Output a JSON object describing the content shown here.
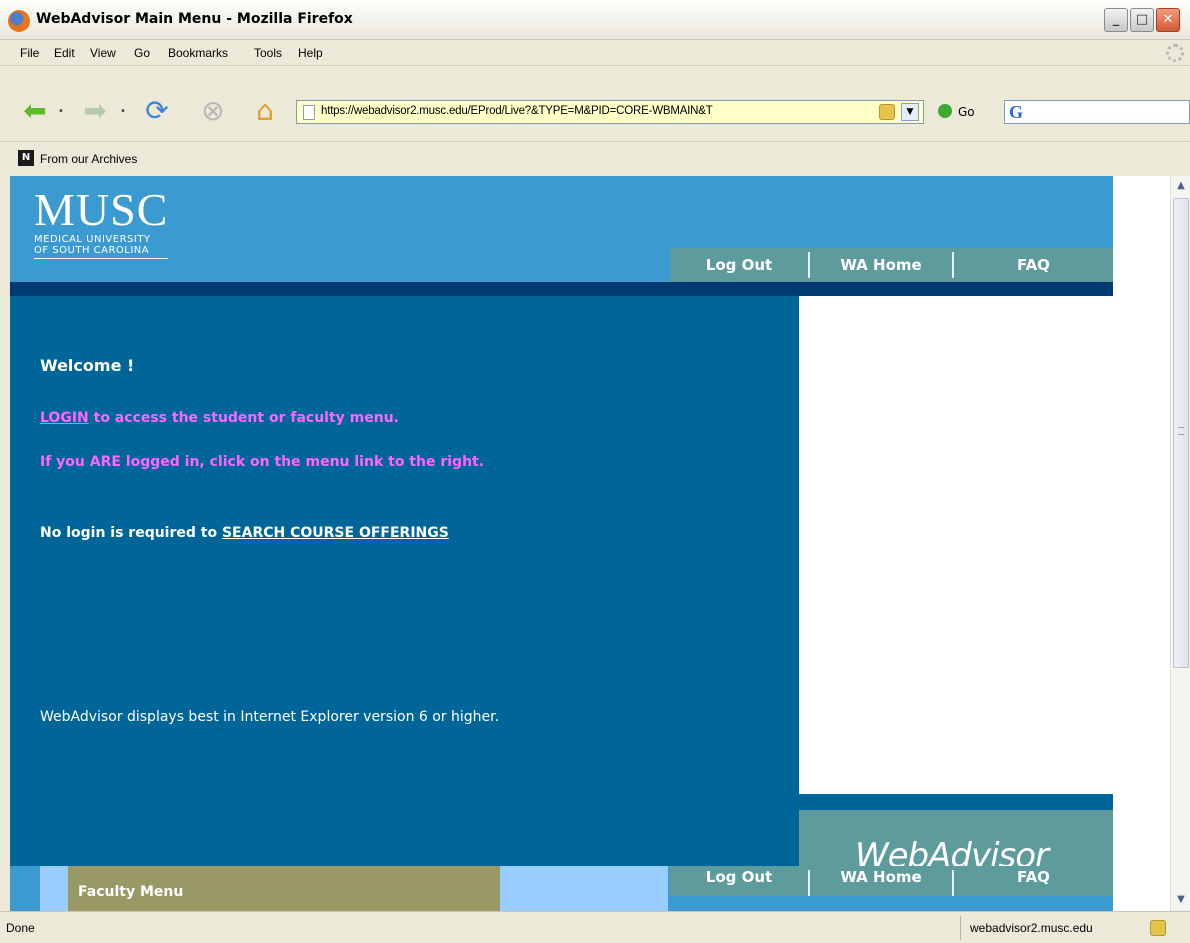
{
  "window": {
    "title": "WebAdvisor Main Menu - Mozilla Firefox"
  },
  "menu": {
    "items": [
      "File",
      "Edit",
      "View",
      "Go",
      "Bookmarks",
      "Tools",
      "Help"
    ]
  },
  "toolbar": {
    "url": "https://webadvisor2.musc.edu/EProd/Live?&TYPE=M&PID=CORE-WBMAIN&T",
    "go_label": "Go"
  },
  "bookmarks": {
    "item_label": "From our Archives"
  },
  "page": {
    "logo": {
      "name": "MUSC",
      "line1": "MEDICAL UNIVERSITY",
      "line2": "OF SOUTH CAROLINA"
    },
    "nav": [
      "Log Out",
      "WA Home",
      "FAQ"
    ],
    "welcome": "Welcome !",
    "login_link": "LOGIN",
    "login_text": " to access the student or faculty menu.",
    "logged_in_text": "If you ARE logged in, click on the menu link to the right.",
    "search_prefix": "No login is required to ",
    "search_link": "SEARCH COURSE OFFERINGS",
    "browser_note": "WebAdvisor displays best in Internet Explorer version 6 or higher.",
    "webadvisor_logo": "WebAdvisor",
    "faculty_menu": "Faculty Menu"
  },
  "status": {
    "left": "Done",
    "right": "webadvisor2.musc.edu"
  },
  "colors": {
    "header_blue": "#3b9ad0",
    "panel_blue": "#006699",
    "link_magenta": "#ff66ff",
    "nav_teal": "#5d9b9c",
    "faculty_olive": "#999966"
  }
}
